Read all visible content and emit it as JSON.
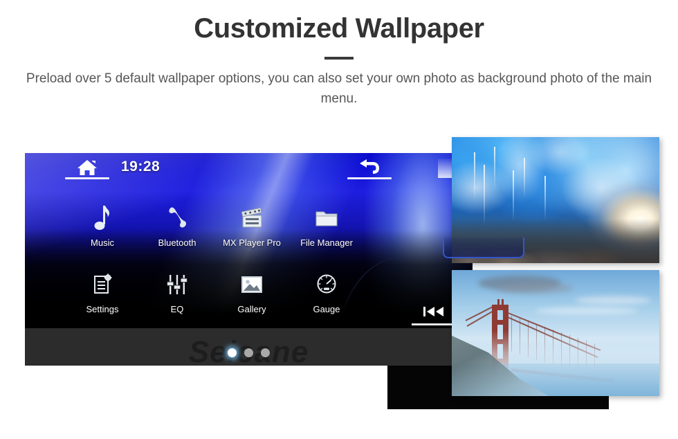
{
  "header": {
    "title": "Customized Wallpaper",
    "subtitle": "Preload over 5 default wallpaper options, you can also set your own photo as background photo of the main menu."
  },
  "head_unit": {
    "clock": "19:28",
    "home_icon": "home-icon",
    "back_icon": "back-arrow-icon",
    "transport_icon": "skip-previous-icon",
    "watermark": "Seicane",
    "pager": {
      "total": 3,
      "active_index": 0
    },
    "apps": [
      {
        "label": "Music",
        "icon": "music-note-icon"
      },
      {
        "label": "Bluetooth",
        "icon": "phone-handset-icon"
      },
      {
        "label": "MX Player Pro",
        "icon": "clapperboard-icon"
      },
      {
        "label": "File Manager",
        "icon": "folder-icon"
      },
      {
        "label": "Settings",
        "icon": "settings-list-gear-icon"
      },
      {
        "label": "EQ",
        "icon": "equalizer-sliders-icon"
      },
      {
        "label": "Gallery",
        "icon": "photo-image-icon"
      },
      {
        "label": "Gauge",
        "icon": "speedometer-icon"
      }
    ]
  },
  "wallpapers": [
    {
      "name": "ice-cave-wallpaper",
      "subject": "Blue ice cave with sunlight"
    },
    {
      "name": "golden-gate-wallpaper",
      "subject": "Golden Gate Bridge in fog"
    }
  ],
  "colors": {
    "title": "#333333",
    "subtitle": "#565656",
    "divider": "#3a3a3a",
    "unit_accent": "#1e1ee0",
    "page_background": "#ffffff"
  }
}
